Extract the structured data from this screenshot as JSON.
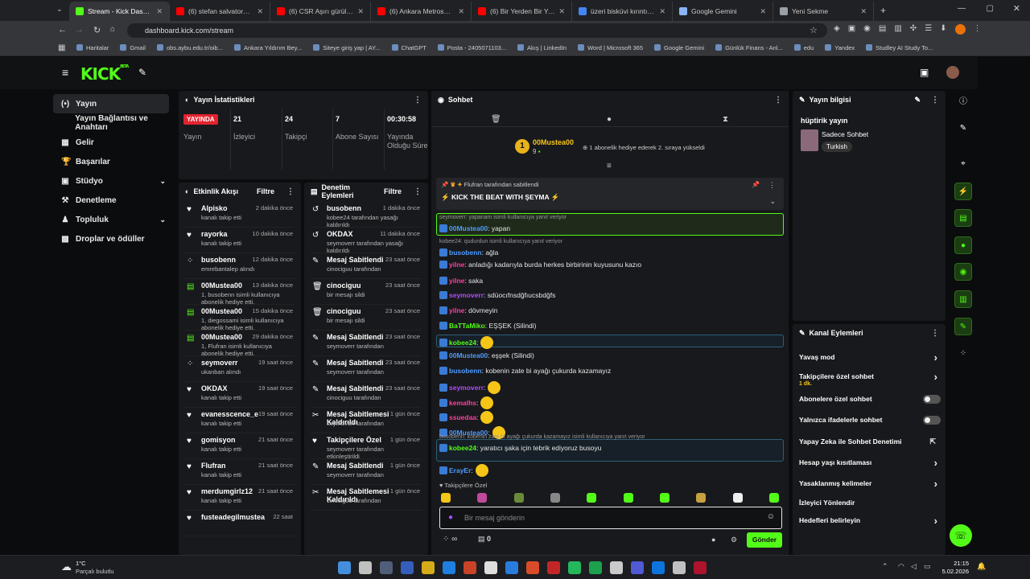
{
  "browser": {
    "tabs": [
      {
        "title": "Stream - Kick Dashboard",
        "color": "#53fc18"
      },
      {
        "title": "(6) stefan salvatore edit -",
        "color": "#ff0000"
      },
      {
        "title": "(6) CSR Aşırı gürültülü me",
        "color": "#ff0000"
      },
      {
        "title": "(6) Ankara Metrosunda O",
        "color": "#ff0000"
      },
      {
        "title": "(6) Bir Yerden Bir Yere \"Ar",
        "color": "#ff0000"
      },
      {
        "title": "üzeri bisküvi kırıntılı tatlı",
        "color": "#4285f4"
      },
      {
        "title": "Google Gemini",
        "color": "#8ab4f8"
      },
      {
        "title": "Yeni Sekme",
        "color": "#9aa0a6"
      }
    ],
    "url": "dashboard.kick.com/stream",
    "bookmarks": [
      "Haritalar",
      "Gmail",
      "obs.aybu.edu.tr/oib...",
      "Ankara Yıldırım Bey...",
      "Siteye giriş yap | AY...",
      "ChatGPT",
      "Posta - 2405071103...",
      "Akış | LinkedIn",
      "Word | Microsoft 365",
      "Google Gemini",
      "Günlük Finans - Anl...",
      "edu",
      "Yandex",
      "Studley AI Study To..."
    ]
  },
  "header": {
    "logo": "KICK",
    "logo_sup": "BETA"
  },
  "sidebar": {
    "items": [
      {
        "label": "Yayın",
        "icon": "(•)"
      },
      {
        "label": "Yayın Bağlantısı ve Anahtarı",
        "icon": ""
      },
      {
        "label": "Gelir",
        "icon": "▦"
      },
      {
        "label": "Başarılar",
        "icon": "🏆"
      },
      {
        "label": "Stüdyo",
        "icon": "▣"
      },
      {
        "label": "Denetleme",
        "icon": "⚒"
      },
      {
        "label": "Topluluk",
        "icon": "♟"
      },
      {
        "label": "Droplar ve ödüller",
        "icon": "▩"
      }
    ]
  },
  "stats": {
    "title": "Yayın İstatistikleri",
    "live_label": "YAYINDA",
    "cells": [
      {
        "value": "",
        "label": "Yayın"
      },
      {
        "value": "21",
        "label": "İzleyici"
      },
      {
        "value": "24",
        "label": "Takipçi"
      },
      {
        "value": "7",
        "label": "Abone Sayısı"
      },
      {
        "value": "00:30:58",
        "label": "Yayında Olduğu Süre"
      }
    ]
  },
  "activity": {
    "title": "Etkinlik Akışı",
    "filter": "Filtre",
    "items": [
      {
        "name": "Alpisko",
        "time": "2 dakika önce",
        "desc": "kanalı takip etti",
        "icon": "♥"
      },
      {
        "name": "rayorka",
        "time": "10 dakika önce",
        "desc": "kanalı takip etti",
        "icon": "♥"
      },
      {
        "name": "busobenn",
        "time": "12 dakika önce",
        "desc": "emrebantalep alındı",
        "icon": "⁘"
      },
      {
        "name": "00Mustea00",
        "time": "13 dakika önce",
        "desc": "1, busobenn isimli kullanıcıya abonelik hediye etti.",
        "icon": "▤"
      },
      {
        "name": "00Mustea00",
        "time": "15 dakika önce",
        "desc": "1, diegossami isimli kullanıcıya abonelik hediye etti.",
        "icon": "▤"
      },
      {
        "name": "00Mustea00",
        "time": "29 dakika önce",
        "desc": "1, Flufran isimli kullanıcıya abonelik hediye etti.",
        "icon": "▤"
      },
      {
        "name": "seymoverr",
        "time": "19 saat önce",
        "desc": "ukanban alındı",
        "icon": "⁘"
      },
      {
        "name": "OKDAX",
        "time": "19 saat önce",
        "desc": "kanalı takip etti",
        "icon": "♥"
      },
      {
        "name": "evanesscence_e",
        "time": "19 saat önce",
        "desc": "kanalı takip etti",
        "icon": "♥"
      },
      {
        "name": "gomisyon",
        "time": "21 saat önce",
        "desc": "kanalı takip etti",
        "icon": "♥"
      },
      {
        "name": "Flufran",
        "time": "21 saat önce",
        "desc": "kanalı takip etti",
        "icon": "♥"
      },
      {
        "name": "merdumgirlz12",
        "time": "21 saat önce",
        "desc": "kanalı takip etti",
        "icon": "♥"
      },
      {
        "name": "fusteadegilmustea",
        "time": "22 saat",
        "desc": "",
        "icon": "♥"
      }
    ]
  },
  "moderation": {
    "title": "Denetim Eylemleri",
    "filter": "Filtre",
    "items": [
      {
        "name": "busobenn",
        "time": "1 dakika önce",
        "desc": "kobee24 tarafından yasağı kaldırıldı",
        "icon": "↺"
      },
      {
        "name": "OKDAX",
        "time": "11 dakika önce",
        "desc": "seymoverr tarafından yasağı kaldırıldı",
        "icon": "↺"
      },
      {
        "name": "Mesaj Sabitlendi",
        "time": "23 saat önce",
        "desc": "cinociguu tarafından",
        "icon": "✎"
      },
      {
        "name": "cinociguu",
        "time": "23 saat önce",
        "desc": "bir mesajı sildi",
        "icon": "🗑"
      },
      {
        "name": "cinociguu",
        "time": "23 saat önce",
        "desc": "bir mesajı sildi",
        "icon": "🗑"
      },
      {
        "name": "Mesaj Sabitlendi",
        "time": "23 saat önce",
        "desc": "seymoverr tarafından",
        "icon": "✎"
      },
      {
        "name": "Mesaj Sabitlendi",
        "time": "23 saat önce",
        "desc": "seymoverr tarafından",
        "icon": "✎"
      },
      {
        "name": "Mesaj Sabitlendi",
        "time": "23 saat önce",
        "desc": "cinociguu tarafından",
        "icon": "✎"
      },
      {
        "name": "Mesaj Sabitlemesi Kaldırıldı",
        "time": "1 gün önce",
        "desc": "seymoverr tarafından",
        "icon": "✂"
      },
      {
        "name": "Takipçilere Özel",
        "time": "1 gün önce",
        "desc": "seymoverr tarafından etkinleştirildi",
        "icon": "♥"
      },
      {
        "name": "Mesaj Sabitlendi",
        "time": "1 gün önce",
        "desc": "seymoverr tarafından",
        "icon": "✎"
      },
      {
        "name": "Mesaj Sabitlemesi Kaldırıldı",
        "time": "1 gün önce",
        "desc": "cinociguu tarafından",
        "icon": "✂"
      }
    ]
  },
  "chat": {
    "title": "Sohbet",
    "gift_user": "00Mustea00",
    "gift_count": "9",
    "gift_text": "1 abonelik hediye ederek 2. sıraya yükseldi",
    "pinned_by": "Flufran tarafından sabitlendi",
    "pinned_text": "KICK THE BEAT WITH ŞEYMA",
    "messages": [
      {
        "reply": "seymoverr: yapanam isimli kullanıcıya yanıt veriyor",
        "user": "00Mustea00",
        "ucolor": "#4f9cff",
        "text": ": yapan"
      },
      {
        "reply": "kobee24: qudurdun isimli kullanıcıya yanıt veriyor",
        "user": "busobenn",
        "ucolor": "#4f9cff",
        "text": ": ağla"
      },
      {
        "reply": "",
        "user": "yilne",
        "ucolor": "#ff3fa4",
        "text": ": anladığı kadarıyla burda herkes birbirinin kuyusunu kazıo"
      },
      {
        "reply": "",
        "user": "yilne",
        "ucolor": "#ff3fa4",
        "text": ": saka"
      },
      {
        "reply": "",
        "user": "seymoverr",
        "ucolor": "#b04cff",
        "text": ": sdüocıfnsdğfıucsbdğfs"
      },
      {
        "reply": "",
        "user": "yilne",
        "ucolor": "#ff3fa4",
        "text": ": dövmeyin"
      },
      {
        "reply": "",
        "user": "BaTTaMiko",
        "ucolor": "#53fc18",
        "text": ": EŞŞEK (Silindi)"
      },
      {
        "reply": "",
        "user": "kobee24",
        "ucolor": "#53fc18",
        "text": ":"
      },
      {
        "reply": "",
        "user": "00Mustea00",
        "ucolor": "#4f9cff",
        "text": ": eşşek (Silindi)"
      },
      {
        "reply": "",
        "user": "busobenn",
        "ucolor": "#4f9cff",
        "text": ": kobenin zate bi ayağı çukurda kazamayız"
      },
      {
        "reply": "",
        "user": "seymoverr",
        "ucolor": "#b04cff",
        "text": ":"
      },
      {
        "reply": "",
        "user": "kemalhs",
        "ucolor": "#ff3fa4",
        "text": ":"
      },
      {
        "reply": "",
        "user": "ssuedaa",
        "ucolor": "#ff3fa4",
        "text": ":"
      },
      {
        "reply": "",
        "user": "00Mustea00",
        "ucolor": "#4f9cff",
        "text": ":"
      },
      {
        "reply": "busobenn: kobenin zate bi ayağı çukurda kazamayız isimli kullanıcıya yanıt veriyor",
        "user": "kobee24",
        "ucolor": "#53fc18",
        "text": ": yaratıcı şaka için tebrik ediyoruz busoyu"
      },
      {
        "reply": "",
        "user": "ErayEr",
        "ucolor": "#4f9cff",
        "text": ":"
      }
    ],
    "followers_only": "Takipçilere Özel",
    "input_placeholder": "Bir mesaj gönderin",
    "send_label": "Gönder",
    "viewer_count": "0"
  },
  "stream_info": {
    "title": "Yayın bilgisi",
    "stream_title": "hüptirik yayın",
    "category": "Sadece Sohbet",
    "language": "Turkish"
  },
  "channel_actions": {
    "title": "Kanal Eylemleri",
    "items": [
      {
        "label": "Yavaş mod",
        "sub": "",
        "control": "chevron"
      },
      {
        "label": "Takipçilere özel sohbet",
        "sub": "1 dk.",
        "control": "chevron"
      },
      {
        "label": "Abonelere özel sohbet",
        "sub": "",
        "control": "toggle"
      },
      {
        "label": "Yalnızca ifadelerle sohbet",
        "sub": "",
        "control": "toggle"
      },
      {
        "label": "Yapay Zeka ile Sohbet Denetimi",
        "sub": "",
        "control": "external"
      },
      {
        "label": "Hesap yaşı kısıtlaması",
        "sub": "",
        "control": "chevron"
      },
      {
        "label": "Yasaklanmış kelimeler",
        "sub": "",
        "control": "chevron"
      },
      {
        "label": "İzleyici Yönlendir",
        "sub": "",
        "control": "none"
      },
      {
        "label": "Hedefleri belirleyin",
        "sub": "",
        "control": "chevron"
      }
    ]
  },
  "taskbar": {
    "weather_temp": "1°C",
    "weather_desc": "Parçalı bulutlu",
    "time": "21:15",
    "date": "5.02.2026"
  },
  "colors": {
    "accent": "#53fc18",
    "live": "#e3232f",
    "panel": "#18191c",
    "bg": "#0b0c0e"
  }
}
